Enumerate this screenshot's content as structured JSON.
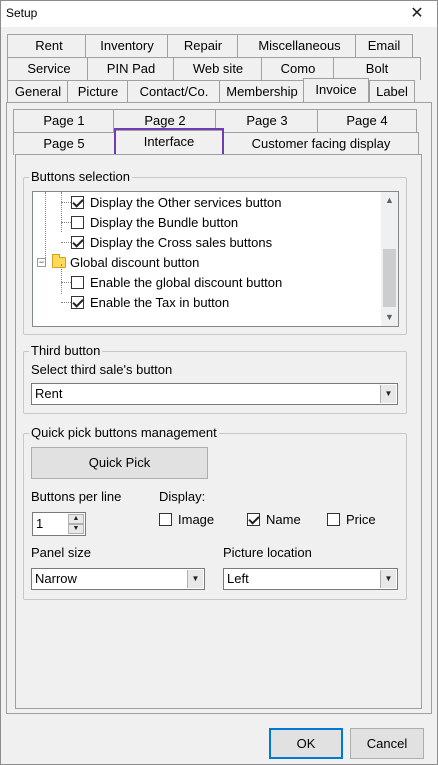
{
  "window": {
    "title": "Setup",
    "close_glyph": "✕"
  },
  "tabs_row1": [
    "Rent",
    "Inventory",
    "Repair",
    "Miscellaneous",
    "Email"
  ],
  "tabs_row2": [
    "Service",
    "PIN Pad",
    "Web site",
    "Como",
    "Bolt"
  ],
  "tabs_row3": [
    "General",
    "Picture",
    "Contact/Co.",
    "Membership",
    "Invoice",
    "Label"
  ],
  "active_main_tab": "Invoice",
  "subtabs_row1": [
    "Page 1",
    "Page 2",
    "Page 3",
    "Page 4"
  ],
  "subtabs_row2": [
    "Page 5",
    "Interface",
    "Customer facing display"
  ],
  "active_sub_tab": "Interface",
  "buttons_selection": {
    "title": "Buttons selection",
    "items": [
      {
        "label": "Display the Other services button",
        "checked": true,
        "type": "checkbox"
      },
      {
        "label": "Display the Bundle button",
        "checked": false,
        "type": "checkbox"
      },
      {
        "label": "Display the Cross sales buttons",
        "checked": true,
        "type": "checkbox"
      },
      {
        "label": "Global discount button",
        "type": "folder",
        "expander": "−"
      },
      {
        "label": "Enable the global discount button",
        "checked": false,
        "type": "checkbox"
      },
      {
        "label": "Enable the Tax in button",
        "checked": true,
        "type": "checkbox"
      }
    ],
    "scroll_up_icon": "▲",
    "scroll_down_icon": "▼"
  },
  "third_button": {
    "title": "Third button",
    "select_label": "Select third sale's button",
    "selected": "Rent"
  },
  "quick_pick": {
    "title": "Quick pick buttons management",
    "button_label": "Quick Pick",
    "per_line_label": "Buttons per line",
    "per_line_value": "1",
    "display_label": "Display:",
    "display_options": [
      {
        "label": "Image",
        "checked": false
      },
      {
        "label": "Name",
        "checked": true
      },
      {
        "label": "Price",
        "checked": false
      }
    ],
    "panel_size_label": "Panel size",
    "panel_size_value": "Narrow",
    "picture_location_label": "Picture location",
    "picture_location_value": "Left"
  },
  "footer": {
    "ok_label": "OK",
    "cancel_label": "Cancel"
  },
  "colors": {
    "focus_highlight": "#6f3cb4",
    "default_button_border": "#0078d7"
  }
}
